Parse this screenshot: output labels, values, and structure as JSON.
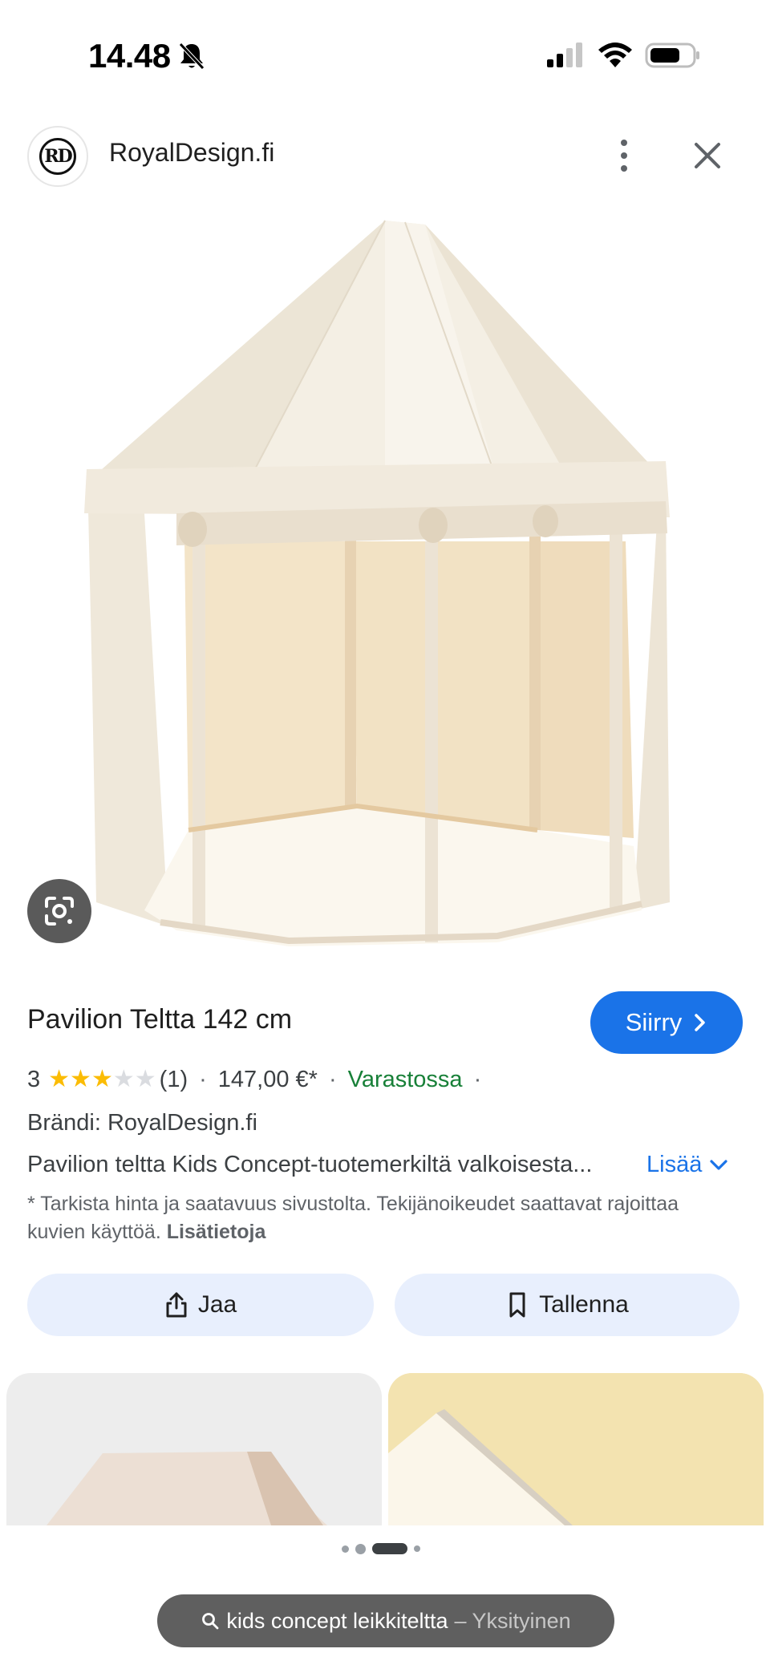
{
  "status_bar": {
    "time": "14.48",
    "icons": [
      "bell-slash-icon",
      "cellular-signal-icon",
      "wifi-icon",
      "battery-icon"
    ]
  },
  "source": {
    "logo_text": "RD",
    "site_name": "RoyalDesign.fi",
    "icons": [
      "more-vert-icon",
      "close-icon"
    ]
  },
  "image": {
    "icons": [
      "google-lens-icon"
    ]
  },
  "product": {
    "title": "Pavilion Teltta 142 cm",
    "visit_label": "Siirry",
    "rating": "3",
    "rating_value": 3,
    "rating_max": 5,
    "review_count": "(1)",
    "price": "147,00 €*",
    "availability": "Varastossa",
    "brand": "Brändi: RoyalDesign.fi",
    "description": "Pavilion teltta Kids Concept-tuotemerkiltä valkoisesta...",
    "more_label": "Lisää",
    "disclaimer": "* Tarkista hinta ja saatavuus sivustolta. Tekijänoikeudet saattavat rajoittaa kuvien käyttöä.",
    "disclaimer_link": "Lisätietoja"
  },
  "actions": {
    "share_label": "Jaa",
    "save_label": "Tallenna"
  },
  "search": {
    "query": "kids concept leikkiteltta",
    "mode": "– Yksityinen"
  },
  "colors": {
    "accent": "#1a73e8",
    "star": "#fbbc04",
    "in_stock": "#188038",
    "action_bg": "#e8effd"
  }
}
